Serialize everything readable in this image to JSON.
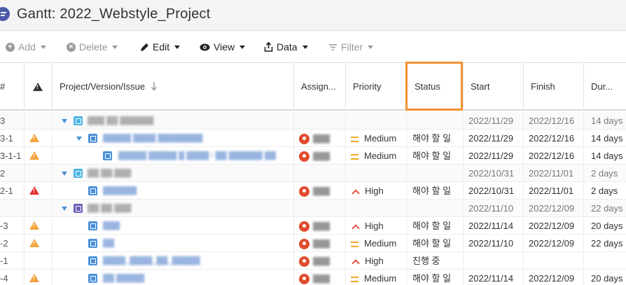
{
  "title": "Gantt:  2022_Webstyle_Project",
  "toolbar": {
    "add": "Add",
    "delete": "Delete",
    "edit": "Edit",
    "view": "View",
    "data": "Data",
    "filter": "Filter"
  },
  "columns": {
    "num": "#",
    "project": "Project/Version/Issue",
    "assignee": "Assign...",
    "priority": "Priority",
    "status": "Status",
    "start": "Start",
    "finish": "Finish",
    "duration": "Dur..."
  },
  "rows": [
    {
      "num": "3",
      "start": "2022/11/29",
      "finish": "2022/12/16",
      "duration": "14 days"
    },
    {
      "num": "3-1",
      "priority": "Medium",
      "status": "해야 할 일",
      "start": "2022/11/29",
      "finish": "2022/12/16",
      "duration": "14 days"
    },
    {
      "num": "3-1-1",
      "priority": "Medium",
      "status": "해야 할 일",
      "start": "2022/11/29",
      "finish": "2022/12/16",
      "duration": "14 days"
    },
    {
      "num": "2",
      "start": "2022/10/31",
      "finish": "2022/11/01",
      "duration": "2 days"
    },
    {
      "num": "2-1",
      "priority": "High",
      "status": "해야 할 일",
      "start": "2022/10/31",
      "finish": "2022/11/01",
      "duration": "2 days"
    },
    {
      "num": "",
      "start": "2022/11/10",
      "finish": "2022/12/09",
      "duration": "22 days"
    },
    {
      "num": "-3",
      "priority": "High",
      "status": "해야 할 일",
      "start": "2022/11/14",
      "finish": "2022/12/09",
      "duration": "20 days"
    },
    {
      "num": "-2",
      "priority": "Medium",
      "status": "해야 할 일",
      "start": "2022/11/10",
      "finish": "2022/12/09",
      "duration": "22 days"
    },
    {
      "num": "-1",
      "priority": "High",
      "status": "진행 중",
      "start": "",
      "finish": "",
      "duration": ""
    },
    {
      "num": "-4",
      "priority": "Medium",
      "status": "해야 할 일",
      "start": "2022/11/14",
      "finish": "2022/12/09",
      "duration": "20 days"
    }
  ],
  "colors": {
    "highlight": "#f39233",
    "warning": "#f3a23a",
    "error": "#e03232",
    "medium": "#f1a624",
    "high": "#e84c3d"
  }
}
